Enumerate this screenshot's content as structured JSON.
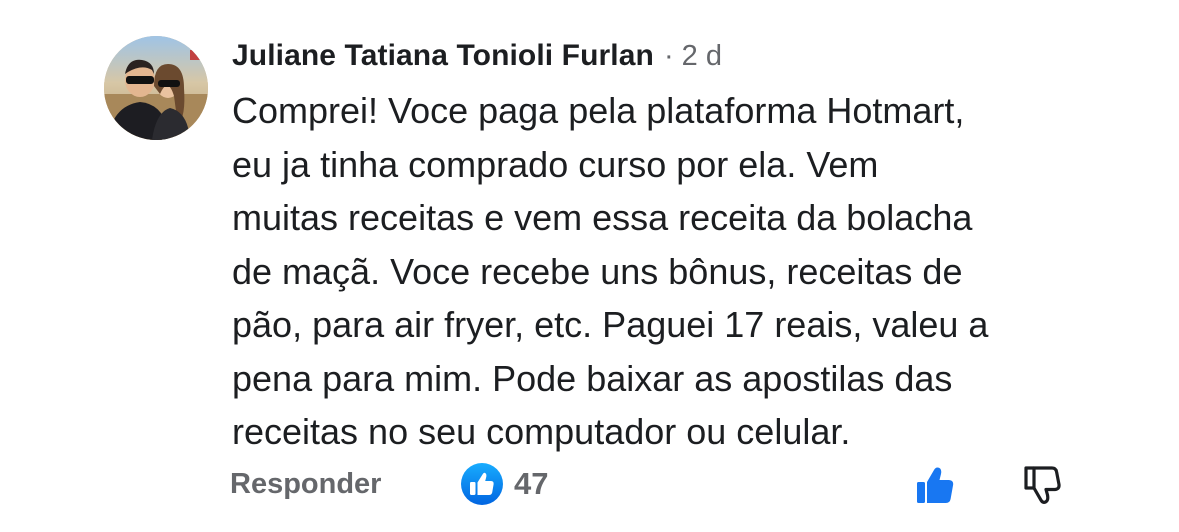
{
  "comment": {
    "author": "Juliane Tatiana Tonioli Furlan",
    "separator": "·",
    "time": "2 d",
    "avatar_icon": "profile-photo-couple",
    "text_lines": [
      "Comprei! Voce paga pela plataforma Hotmart,",
      "eu ja tinha comprado curso por ela. Vem",
      "muitas receitas e vem essa receita da bolacha",
      "de maçã. Voce recebe uns bônus, receitas de",
      "pão, para air fryer, etc. Paguei 17 reais, valeu a",
      "pena para mim. Pode baixar as apostilas das",
      "receitas no seu computador ou celular."
    ]
  },
  "actions": {
    "reply_label": "Responder",
    "reaction_count": "47",
    "reaction_icon": "like-reaction-icon",
    "like_icon": "thumbs-up-icon",
    "dislike_icon": "thumbs-down-icon"
  },
  "colors": {
    "author": "#1c1e21",
    "meta": "#65676b",
    "like_blue": "#1877f2",
    "reaction_gradient_top": "#18acfe",
    "reaction_gradient_bottom": "#0165e1"
  }
}
